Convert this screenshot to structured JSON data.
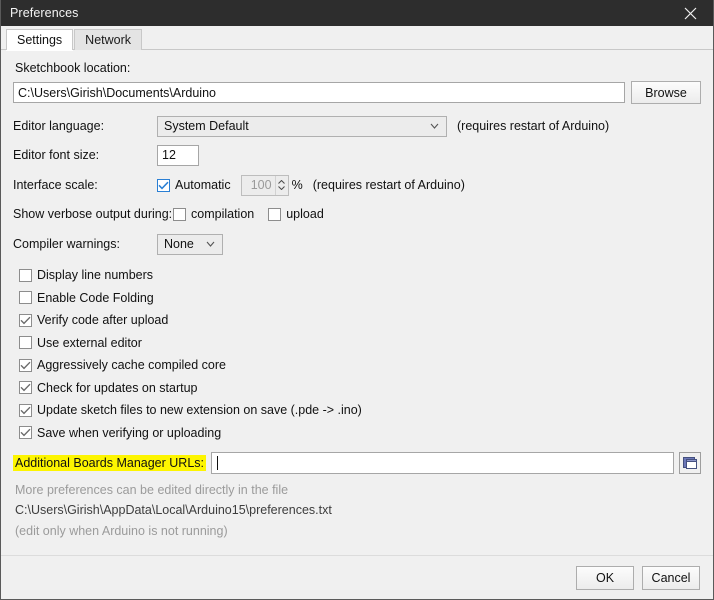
{
  "window": {
    "title": "Preferences",
    "close_icon": "close-icon"
  },
  "tabs": [
    {
      "label": "Settings",
      "active": true
    },
    {
      "label": "Network",
      "active": false
    }
  ],
  "settings": {
    "sketchbook": {
      "label": "Sketchbook location:",
      "value": "C:\\Users\\Girish\\Documents\\Arduino",
      "browse_label": "Browse"
    },
    "editor_language": {
      "label": "Editor language:",
      "value": "System Default",
      "hint": "(requires restart of Arduino)"
    },
    "editor_font_size": {
      "label": "Editor font size:",
      "value": "12"
    },
    "interface_scale": {
      "label": "Interface scale:",
      "automatic_label": "Automatic",
      "automatic_checked": true,
      "scale_value": "100",
      "percent": "%",
      "hint": "(requires restart of Arduino)"
    },
    "verbose_output": {
      "label": "Show verbose output during:",
      "compilation_label": "compilation",
      "compilation_checked": false,
      "upload_label": "upload",
      "upload_checked": false
    },
    "compiler_warnings": {
      "label": "Compiler warnings:",
      "value": "None"
    },
    "checkboxes": [
      {
        "label": "Display line numbers",
        "checked": false
      },
      {
        "label": "Enable Code Folding",
        "checked": false
      },
      {
        "label": "Verify code after upload",
        "checked": true
      },
      {
        "label": "Use external editor",
        "checked": false
      },
      {
        "label": "Aggressively cache compiled core",
        "checked": true
      },
      {
        "label": "Check for updates on startup",
        "checked": true
      },
      {
        "label": "Update sketch files to new extension on save (.pde -> .ino)",
        "checked": true
      },
      {
        "label": "Save when verifying or uploading",
        "checked": true
      }
    ],
    "boards_manager": {
      "label": "Additional Boards Manager URLs:",
      "value": "",
      "highlight_color": "#fdf500",
      "edit_icon": "external-window-icon"
    },
    "notes": {
      "line1": "More preferences can be edited directly in the file",
      "path": "C:\\Users\\Girish\\AppData\\Local\\Arduino15\\preferences.txt",
      "line3": "(edit only when Arduino is not running)"
    }
  },
  "footer": {
    "ok_label": "OK",
    "cancel_label": "Cancel"
  }
}
